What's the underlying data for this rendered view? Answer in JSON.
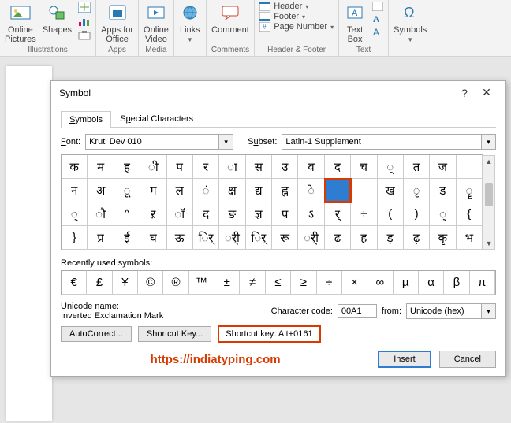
{
  "ribbon": {
    "groups": [
      {
        "label": "Illustrations",
        "items": [
          {
            "name": "online-pictures",
            "label": "Online\nPictures"
          },
          {
            "name": "shapes",
            "label": "Shapes"
          }
        ]
      },
      {
        "label": "Apps",
        "items": [
          {
            "name": "apps-for-office",
            "label": "Apps for\nOffice"
          }
        ]
      },
      {
        "label": "Media",
        "items": [
          {
            "name": "online-video",
            "label": "Online\nVideo"
          }
        ]
      },
      {
        "label": "",
        "items": [
          {
            "name": "links",
            "label": "Links"
          }
        ]
      },
      {
        "label": "Comments",
        "items": [
          {
            "name": "comment",
            "label": "Comment"
          }
        ]
      },
      {
        "label": "Header & Footer",
        "stack": [
          "Header",
          "Footer",
          "Page Number"
        ]
      },
      {
        "label": "Text",
        "items": [
          {
            "name": "text-box",
            "label": "Text\nBox"
          }
        ]
      },
      {
        "label": "",
        "items": [
          {
            "name": "symbols",
            "label": "Symbols"
          }
        ]
      }
    ]
  },
  "dialog": {
    "title": "Symbol",
    "tabs": [
      "Symbols",
      "Special Characters"
    ],
    "font_label": "Font:",
    "font_value": "Kruti Dev 010",
    "subset_label": "Subset:",
    "subset_value": "Latin-1 Supplement",
    "grid": [
      [
        "क",
        "म",
        "ह",
        "ी",
        "प",
        "र",
        "ा",
        "स",
        "उ",
        "व",
        "द",
        "च",
        "्",
        "त",
        "ज",
        " "
      ],
      [
        "न",
        "अ",
        "ू",
        "ग",
        "ल",
        "ं",
        "क्ष",
        "द्य",
        "ह्न",
        "े",
        "",
        "",
        "ख",
        "ृ",
        "ड",
        "ॄ"
      ],
      [
        "्",
        "ौ",
        "^",
        "ऱ",
        "ॉ",
        "द",
        "ङ",
        "ज्ञ",
        "प",
        "ऽ",
        "र्",
        "÷",
        "(",
        ")",
        "्",
        "{"
      ],
      [
        "}",
        "प्र",
        "ई",
        "घ",
        "ऊ",
        "र्ि",
        "र्ी",
        "र्ि",
        "रू",
        "र्ी",
        "ढ",
        "ह",
        "ड़",
        "ढ़",
        "कृ",
        "भ"
      ]
    ],
    "selected": {
      "row": 1,
      "col": 10
    },
    "recent_label": "Recently used symbols:",
    "recent": [
      "€",
      "£",
      "¥",
      "©",
      "®",
      "™",
      "±",
      "≠",
      "≤",
      "≥",
      "÷",
      "×",
      "∞",
      "µ",
      "α",
      "β",
      "π"
    ],
    "unicode_name_label": "Unicode name:",
    "unicode_name": "Inverted Exclamation Mark",
    "charcode_label": "Character code:",
    "charcode_value": "00A1",
    "from_label": "from:",
    "from_value": "Unicode (hex)",
    "autocorrect_btn": "AutoCorrect...",
    "shortcut_btn": "Shortcut Key...",
    "shortcut_text": "Shortcut key: Alt+0161",
    "watermark": "https://indiatyping.com",
    "insert_btn": "Insert",
    "cancel_btn": "Cancel"
  }
}
